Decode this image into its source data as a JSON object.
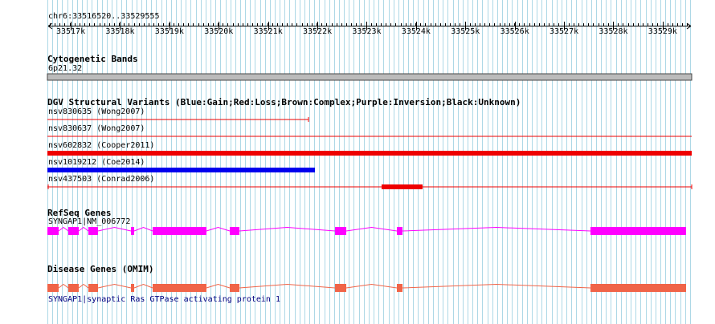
{
  "ruler": {
    "locus": "chr6:33516520..33529555",
    "ticks": [
      "33517k",
      "33518k",
      "33519k",
      "33520k",
      "33521k",
      "33522k",
      "33523k",
      "33524k",
      "33525k",
      "33526k",
      "33527k",
      "33528k",
      "33529k"
    ]
  },
  "tracks": {
    "cytoband": {
      "title": "Cytogenetic Bands",
      "label": "6p21.32"
    },
    "dgv": {
      "title": "DGV Structural Variants (Blue:Gain;Red:Loss;Brown:Complex;Purple:Inversion;Black:Unknown)",
      "features": [
        {
          "label": "nsv830635 (Wong2007)",
          "color": "#ee0000"
        },
        {
          "label": "nsv830637 (Wong2007)",
          "color": "#ee0000"
        },
        {
          "label": "nsv602832 (Cooper2011)",
          "color": "#ee0000"
        },
        {
          "label": "nsv1019212 (Coe2014)",
          "color": "#0000ee"
        },
        {
          "label": "nsv437503 (Conrad2006)",
          "color": "#ee0000"
        }
      ]
    },
    "refseq": {
      "title": "RefSeq Genes",
      "label": "SYNGAP1|NM_006772",
      "color": "#ff00ff"
    },
    "omim": {
      "title": "Disease Genes (OMIM)",
      "label": "SYNGAP1|synaptic Ras GTPase activating protein 1",
      "color": "#f06448"
    }
  },
  "colors": {
    "gridline": "#add8e6",
    "cytoband_fill": "#bbbbbb",
    "link_text": "#000080"
  }
}
